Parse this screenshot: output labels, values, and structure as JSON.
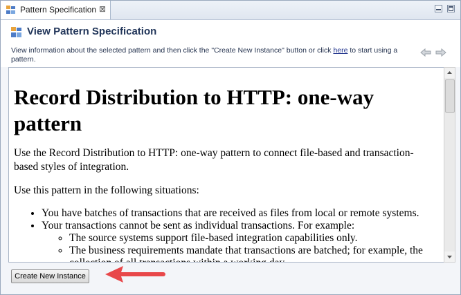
{
  "tab": {
    "title": "Pattern Specification",
    "close_glyph": "⊠"
  },
  "header": {
    "title": "View Pattern Specification",
    "desc_before": "View information about the selected pattern and then click the \"Create New Instance\" button or click ",
    "desc_link": "here",
    "desc_after": " to start using a pattern."
  },
  "doc": {
    "heading": "Record Distribution to HTTP: one-way pattern",
    "intro": "Use the Record Distribution to HTTP: one-way pattern to connect file-based and transaction-based styles of integration.",
    "situations_intro": "Use this pattern in the following situations:",
    "bullets": [
      "You have batches of transactions that are received as files from local or remote systems.",
      "Your transactions cannot be sent as individual transactions. For example:"
    ],
    "sub_bullets": [
      "The source systems support file-based integration capabilities only.",
      "The business requirements mandate that transactions are batched; for example, the",
      "collection of all transactions within a working day."
    ]
  },
  "actions": {
    "create_label": "Create New Instance"
  },
  "colors": {
    "title": "#22365a",
    "link": "#1c2f8a",
    "arrow": "#e8474a"
  },
  "icons": [
    "pattern-icon",
    "close-icon",
    "minimize-icon",
    "maximize-icon",
    "back-arrow-icon",
    "forward-arrow-icon",
    "scroll-up-icon",
    "scroll-down-icon",
    "annotation-arrow"
  ]
}
